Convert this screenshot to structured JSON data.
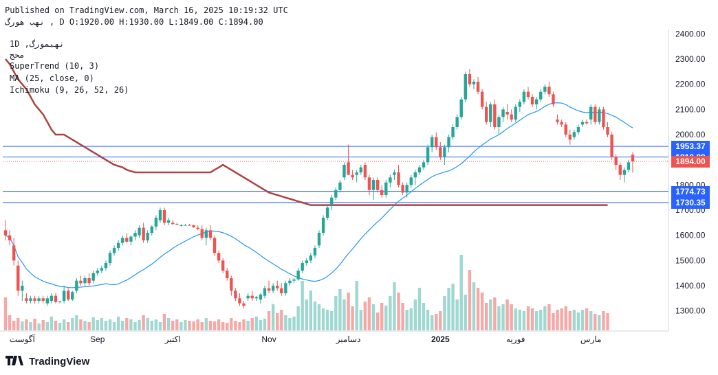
{
  "header": {
    "published": "Published on TradingView.com, March 16, 2025 10:19:32 UTC",
    "symbol_line": "نهب هورگ , D O:1920.00 H:1930.00 L:1849.00 C:1894.00"
  },
  "legend": {
    "symbol": "1D ,نهبمورگ",
    "exchange": "محج",
    "supertrend": "SuperTrend (10, 3)",
    "ma": "MA (25, close, 0)",
    "ichimoku": "Ichimoku (9, 26, 52, 26)"
  },
  "colors": {
    "up": "#26a69a",
    "down": "#ef5350",
    "supertrend_up": "#4caf50",
    "supertrend_down": "#a94442",
    "ma": "#2196f3",
    "hline": "#2962ff",
    "cloud_bull": "#d7ecd7",
    "cloud_bear": "#fbdcdc"
  },
  "footer": {
    "brand": "TradingView"
  },
  "chart_data": {
    "type": "candlestick",
    "title": "",
    "ylim": [
      1220,
      2420
    ],
    "y_ticks": [
      2400,
      2300,
      2200,
      2100,
      2000,
      1900,
      1800,
      1700,
      1600,
      1500,
      1400,
      1300
    ],
    "y_tick_labels": [
      "2400.00",
      "2300.00",
      "2200.00",
      "2100.00",
      "2000.00",
      "1900.00",
      "1800.00",
      "1700.00",
      "1600.00",
      "1500.00",
      "1400.00",
      "1300.00"
    ],
    "x_labels": [
      {
        "text": "آگوست",
        "index": 4
      },
      {
        "text": "Sep",
        "index": 22
      },
      {
        "text": "اکتبر",
        "index": 40
      },
      {
        "text": "Nov",
        "index": 63
      },
      {
        "text": "دسامبر",
        "index": 82
      },
      {
        "text": "2025",
        "index": 104
      },
      {
        "text": "فوریه",
        "index": 122
      },
      {
        "text": "مارس",
        "index": 140
      }
    ],
    "candles": [
      {
        "o": 1620,
        "h": 1660,
        "l": 1580,
        "c": 1600
      },
      {
        "o": 1600,
        "h": 1620,
        "l": 1560,
        "c": 1580
      },
      {
        "o": 1560,
        "h": 1590,
        "l": 1480,
        "c": 1500
      },
      {
        "o": 1480,
        "h": 1500,
        "l": 1360,
        "c": 1380
      },
      {
        "o": 1380,
        "h": 1420,
        "l": 1340,
        "c": 1400
      },
      {
        "o": 1350,
        "h": 1370,
        "l": 1330,
        "c": 1340
      },
      {
        "o": 1340,
        "h": 1360,
        "l": 1330,
        "c": 1350
      },
      {
        "o": 1350,
        "h": 1360,
        "l": 1330,
        "c": 1340
      },
      {
        "o": 1340,
        "h": 1360,
        "l": 1330,
        "c": 1350
      },
      {
        "o": 1350,
        "h": 1360,
        "l": 1330,
        "c": 1340
      },
      {
        "o": 1330,
        "h": 1360,
        "l": 1320,
        "c": 1350
      },
      {
        "o": 1340,
        "h": 1370,
        "l": 1330,
        "c": 1360
      },
      {
        "o": 1360,
        "h": 1370,
        "l": 1330,
        "c": 1335
      },
      {
        "o": 1335,
        "h": 1340,
        "l": 1330,
        "c": 1338
      },
      {
        "o": 1340,
        "h": 1400,
        "l": 1330,
        "c": 1380
      },
      {
        "o": 1380,
        "h": 1390,
        "l": 1340,
        "c": 1345
      },
      {
        "o": 1345,
        "h": 1380,
        "l": 1340,
        "c": 1375
      },
      {
        "o": 1380,
        "h": 1430,
        "l": 1370,
        "c": 1420
      },
      {
        "o": 1420,
        "h": 1440,
        "l": 1400,
        "c": 1410
      },
      {
        "o": 1410,
        "h": 1440,
        "l": 1400,
        "c": 1430
      },
      {
        "o": 1430,
        "h": 1450,
        "l": 1400,
        "c": 1410
      },
      {
        "o": 1420,
        "h": 1460,
        "l": 1410,
        "c": 1450
      },
      {
        "o": 1450,
        "h": 1470,
        "l": 1440,
        "c": 1460
      },
      {
        "o": 1460,
        "h": 1480,
        "l": 1450,
        "c": 1470
      },
      {
        "o": 1470,
        "h": 1500,
        "l": 1460,
        "c": 1490
      },
      {
        "o": 1490,
        "h": 1540,
        "l": 1480,
        "c": 1530
      },
      {
        "o": 1530,
        "h": 1560,
        "l": 1520,
        "c": 1550
      },
      {
        "o": 1550,
        "h": 1580,
        "l": 1540,
        "c": 1570
      },
      {
        "o": 1570,
        "h": 1600,
        "l": 1560,
        "c": 1590
      },
      {
        "o": 1590,
        "h": 1610,
        "l": 1570,
        "c": 1575
      },
      {
        "o": 1575,
        "h": 1600,
        "l": 1560,
        "c": 1595
      },
      {
        "o": 1595,
        "h": 1620,
        "l": 1580,
        "c": 1610
      },
      {
        "o": 1600,
        "h": 1640,
        "l": 1590,
        "c": 1630
      },
      {
        "o": 1630,
        "h": 1650,
        "l": 1570,
        "c": 1580
      },
      {
        "o": 1580,
        "h": 1620,
        "l": 1570,
        "c": 1610
      },
      {
        "o": 1610,
        "h": 1640,
        "l": 1600,
        "c": 1635
      },
      {
        "o": 1635,
        "h": 1680,
        "l": 1620,
        "c": 1670
      },
      {
        "o": 1660,
        "h": 1710,
        "l": 1650,
        "c": 1700
      },
      {
        "o": 1700,
        "h": 1710,
        "l": 1640,
        "c": 1650
      },
      {
        "o": 1650,
        "h": 1670,
        "l": 1640,
        "c": 1660
      },
      {
        "o": 1650,
        "h": 1660,
        "l": 1640,
        "c": 1645
      },
      {
        "o": 1645,
        "h": 1650,
        "l": 1640,
        "c": 1642
      },
      {
        "o": 1640,
        "h": 1645,
        "l": 1635,
        "c": 1640
      },
      {
        "o": 1640,
        "h": 1645,
        "l": 1638,
        "c": 1641
      },
      {
        "o": 1641,
        "h": 1645,
        "l": 1638,
        "c": 1640
      },
      {
        "o": 1640,
        "h": 1642,
        "l": 1630,
        "c": 1632
      },
      {
        "o": 1630,
        "h": 1640,
        "l": 1620,
        "c": 1625
      },
      {
        "o": 1625,
        "h": 1640,
        "l": 1580,
        "c": 1590
      },
      {
        "o": 1590,
        "h": 1630,
        "l": 1560,
        "c": 1620
      },
      {
        "o": 1620,
        "h": 1640,
        "l": 1580,
        "c": 1590
      },
      {
        "o": 1590,
        "h": 1600,
        "l": 1520,
        "c": 1530
      },
      {
        "o": 1530,
        "h": 1540,
        "l": 1490,
        "c": 1500
      },
      {
        "o": 1500,
        "h": 1510,
        "l": 1450,
        "c": 1460
      },
      {
        "o": 1460,
        "h": 1470,
        "l": 1420,
        "c": 1430
      },
      {
        "o": 1430,
        "h": 1440,
        "l": 1360,
        "c": 1380
      },
      {
        "o": 1380,
        "h": 1390,
        "l": 1340,
        "c": 1350
      },
      {
        "o": 1350,
        "h": 1370,
        "l": 1320,
        "c": 1330
      },
      {
        "o": 1330,
        "h": 1340,
        "l": 1310,
        "c": 1320
      },
      {
        "o": 1350,
        "h": 1370,
        "l": 1340,
        "c": 1360
      },
      {
        "o": 1360,
        "h": 1380,
        "l": 1340,
        "c": 1350
      },
      {
        "o": 1350,
        "h": 1360,
        "l": 1340,
        "c": 1355
      },
      {
        "o": 1345,
        "h": 1370,
        "l": 1330,
        "c": 1365
      },
      {
        "o": 1360,
        "h": 1400,
        "l": 1350,
        "c": 1390
      },
      {
        "o": 1390,
        "h": 1420,
        "l": 1370,
        "c": 1380
      },
      {
        "o": 1380,
        "h": 1410,
        "l": 1370,
        "c": 1400
      },
      {
        "o": 1400,
        "h": 1420,
        "l": 1380,
        "c": 1390
      },
      {
        "o": 1390,
        "h": 1410,
        "l": 1360,
        "c": 1370
      },
      {
        "o": 1370,
        "h": 1420,
        "l": 1360,
        "c": 1410
      },
      {
        "o": 1410,
        "h": 1430,
        "l": 1400,
        "c": 1420
      },
      {
        "o": 1420,
        "h": 1430,
        "l": 1410,
        "c": 1425
      },
      {
        "o": 1425,
        "h": 1470,
        "l": 1420,
        "c": 1460
      },
      {
        "o": 1460,
        "h": 1500,
        "l": 1450,
        "c": 1490
      },
      {
        "o": 1490,
        "h": 1510,
        "l": 1480,
        "c": 1500
      },
      {
        "o": 1500,
        "h": 1530,
        "l": 1490,
        "c": 1520
      },
      {
        "o": 1520,
        "h": 1560,
        "l": 1510,
        "c": 1550
      },
      {
        "o": 1560,
        "h": 1620,
        "l": 1550,
        "c": 1610
      },
      {
        "o": 1610,
        "h": 1680,
        "l": 1600,
        "c": 1670
      },
      {
        "o": 1670,
        "h": 1720,
        "l": 1660,
        "c": 1710
      },
      {
        "o": 1720,
        "h": 1760,
        "l": 1700,
        "c": 1750
      },
      {
        "o": 1750,
        "h": 1790,
        "l": 1740,
        "c": 1780
      },
      {
        "o": 1780,
        "h": 1820,
        "l": 1770,
        "c": 1810
      },
      {
        "o": 1830,
        "h": 1890,
        "l": 1820,
        "c": 1880
      },
      {
        "o": 1890,
        "h": 1960,
        "l": 1850,
        "c": 1840
      },
      {
        "o": 1840,
        "h": 1860,
        "l": 1820,
        "c": 1830
      },
      {
        "o": 1840,
        "h": 1860,
        "l": 1810,
        "c": 1850
      },
      {
        "o": 1850,
        "h": 1880,
        "l": 1840,
        "c": 1870
      },
      {
        "o": 1880,
        "h": 1890,
        "l": 1820,
        "c": 1830
      },
      {
        "o": 1830,
        "h": 1840,
        "l": 1760,
        "c": 1780
      },
      {
        "o": 1780,
        "h": 1830,
        "l": 1740,
        "c": 1820
      },
      {
        "o": 1820,
        "h": 1830,
        "l": 1770,
        "c": 1780
      },
      {
        "o": 1780,
        "h": 1800,
        "l": 1750,
        "c": 1760
      },
      {
        "o": 1760,
        "h": 1820,
        "l": 1750,
        "c": 1810
      },
      {
        "o": 1810,
        "h": 1840,
        "l": 1790,
        "c": 1830
      },
      {
        "o": 1840,
        "h": 1860,
        "l": 1820,
        "c": 1850
      },
      {
        "o": 1850,
        "h": 1880,
        "l": 1790,
        "c": 1800
      },
      {
        "o": 1800,
        "h": 1810,
        "l": 1760,
        "c": 1770
      },
      {
        "o": 1770,
        "h": 1810,
        "l": 1750,
        "c": 1800
      },
      {
        "o": 1800,
        "h": 1840,
        "l": 1790,
        "c": 1830
      },
      {
        "o": 1830,
        "h": 1860,
        "l": 1800,
        "c": 1850
      },
      {
        "o": 1850,
        "h": 1880,
        "l": 1840,
        "c": 1870
      },
      {
        "o": 1870,
        "h": 1900,
        "l": 1860,
        "c": 1890
      },
      {
        "o": 1890,
        "h": 1960,
        "l": 1880,
        "c": 1950
      },
      {
        "o": 1950,
        "h": 2000,
        "l": 1930,
        "c": 1990
      },
      {
        "o": 1990,
        "h": 2010,
        "l": 1940,
        "c": 1950
      },
      {
        "o": 1950,
        "h": 1970,
        "l": 1900,
        "c": 1910
      },
      {
        "o": 1910,
        "h": 1960,
        "l": 1880,
        "c": 1950
      },
      {
        "o": 1950,
        "h": 2000,
        "l": 1930,
        "c": 1990
      },
      {
        "o": 1990,
        "h": 2040,
        "l": 1980,
        "c": 2030
      },
      {
        "o": 2030,
        "h": 2080,
        "l": 2020,
        "c": 2070
      },
      {
        "o": 2070,
        "h": 2150,
        "l": 2060,
        "c": 2140
      },
      {
        "o": 2140,
        "h": 2250,
        "l": 2130,
        "c": 2240
      },
      {
        "o": 2240,
        "h": 2260,
        "l": 2190,
        "c": 2200
      },
      {
        "o": 2200,
        "h": 2220,
        "l": 2180,
        "c": 2210
      },
      {
        "o": 2210,
        "h": 2230,
        "l": 2160,
        "c": 2170
      },
      {
        "o": 2170,
        "h": 2180,
        "l": 2100,
        "c": 2110
      },
      {
        "o": 2110,
        "h": 2130,
        "l": 2040,
        "c": 2050
      },
      {
        "o": 2050,
        "h": 2130,
        "l": 2030,
        "c": 2120
      },
      {
        "o": 2120,
        "h": 2140,
        "l": 2020,
        "c": 2030
      },
      {
        "o": 2030,
        "h": 2080,
        "l": 2000,
        "c": 2070
      },
      {
        "o": 2070,
        "h": 2110,
        "l": 2050,
        "c": 2100
      },
      {
        "o": 2090,
        "h": 2120,
        "l": 2060,
        "c": 2080
      },
      {
        "o": 2080,
        "h": 2100,
        "l": 2050,
        "c": 2060
      },
      {
        "o": 2060,
        "h": 2120,
        "l": 2050,
        "c": 2110
      },
      {
        "o": 2110,
        "h": 2140,
        "l": 2090,
        "c": 2130
      },
      {
        "o": 2130,
        "h": 2180,
        "l": 2120,
        "c": 2170
      },
      {
        "o": 2170,
        "h": 2190,
        "l": 2140,
        "c": 2150
      },
      {
        "o": 2150,
        "h": 2160,
        "l": 2110,
        "c": 2120
      },
      {
        "o": 2120,
        "h": 2150,
        "l": 2100,
        "c": 2140
      },
      {
        "o": 2140,
        "h": 2180,
        "l": 2130,
        "c": 2170
      },
      {
        "o": 2170,
        "h": 2200,
        "l": 2160,
        "c": 2190
      },
      {
        "o": 2190,
        "h": 2210,
        "l": 2150,
        "c": 2160
      },
      {
        "o": 2160,
        "h": 2170,
        "l": 2110,
        "c": 2120
      },
      {
        "o": 2060,
        "h": 2080,
        "l": 2040,
        "c": 2050
      },
      {
        "o": 2050,
        "h": 2060,
        "l": 2030,
        "c": 2040
      },
      {
        "o": 2040,
        "h": 2050,
        "l": 1990,
        "c": 2000
      },
      {
        "o": 2000,
        "h": 2020,
        "l": 1960,
        "c": 1980
      },
      {
        "o": 1990,
        "h": 2020,
        "l": 1980,
        "c": 2010
      },
      {
        "o": 2010,
        "h": 2040,
        "l": 2000,
        "c": 2030
      },
      {
        "o": 2040,
        "h": 2060,
        "l": 2030,
        "c": 2050
      },
      {
        "o": 2050,
        "h": 2060,
        "l": 2040,
        "c": 2045
      },
      {
        "o": 2060,
        "h": 2120,
        "l": 2040,
        "c": 2110
      },
      {
        "o": 2110,
        "h": 2120,
        "l": 2040,
        "c": 2050
      },
      {
        "o": 2050,
        "h": 2110,
        "l": 2040,
        "c": 2100
      },
      {
        "o": 2100,
        "h": 2110,
        "l": 2020,
        "c": 2030
      },
      {
        "o": 2030,
        "h": 2050,
        "l": 1990,
        "c": 2000
      },
      {
        "o": 2000,
        "h": 2010,
        "l": 1900,
        "c": 1910
      },
      {
        "o": 1910,
        "h": 1920,
        "l": 1860,
        "c": 1880
      },
      {
        "o": 1880,
        "h": 1890,
        "l": 1820,
        "c": 1840
      },
      {
        "o": 1840,
        "h": 1870,
        "l": 1810,
        "c": 1860
      },
      {
        "o": 1860,
        "h": 1900,
        "l": 1850,
        "c": 1890
      },
      {
        "o": 1920,
        "h": 1930,
        "l": 1849,
        "c": 1894
      }
    ],
    "volume": [
      48,
      22,
      14,
      18,
      13,
      16,
      12,
      17,
      10,
      15,
      12,
      20,
      14,
      11,
      16,
      12,
      18,
      22,
      16,
      14,
      12,
      19,
      15,
      18,
      14,
      16,
      12,
      20,
      14,
      18,
      16,
      12,
      15,
      22,
      18,
      14,
      16,
      12,
      24,
      18,
      14,
      16,
      12,
      15,
      14,
      13,
      16,
      12,
      18,
      14,
      13,
      16,
      12,
      11,
      18,
      14,
      12,
      16,
      14,
      18,
      20,
      15,
      17,
      28,
      38,
      25,
      30,
      22,
      18,
      20,
      35,
      72,
      45,
      58,
      42,
      38,
      32,
      30,
      28,
      50,
      60,
      45,
      55,
      35,
      72,
      30,
      42,
      48,
      38,
      26,
      40,
      36,
      50,
      70,
      55,
      40,
      30,
      32,
      45,
      62,
      40,
      30,
      22,
      24,
      28,
      50,
      62,
      68,
      45,
      110,
      52,
      88,
      70,
      62,
      55,
      40,
      45,
      48,
      35,
      38,
      45,
      38,
      32,
      30,
      28,
      35,
      32,
      28,
      30,
      35,
      38,
      25,
      30,
      32,
      35,
      28,
      30,
      26,
      30,
      32,
      28,
      24,
      22,
      28,
      25
    ],
    "supertrend": [
      2300,
      2280,
      2250,
      2220,
      2200,
      2180,
      2150,
      2120,
      2100,
      2080,
      2050,
      2020,
      2000,
      2000,
      2000,
      1990,
      1980,
      1970,
      1960,
      1950,
      1940,
      1930,
      1920,
      1910,
      1900,
      1890,
      1880,
      1875,
      1870,
      1860,
      1855,
      1850,
      1850,
      1850,
      1850,
      1850,
      1850,
      1850,
      1850,
      1850,
      1850,
      1850,
      1850,
      1850,
      1850,
      1850,
      1850,
      1850,
      1850,
      1850,
      1860,
      1870,
      1880,
      1870,
      1860,
      1850,
      1840,
      1830,
      1820,
      1810,
      1800,
      1790,
      1780,
      1770,
      1765,
      1760,
      1755,
      1750,
      1745,
      1740,
      1735,
      1730,
      1725,
      1720,
      1720,
      1720,
      1720,
      1720,
      1720,
      1720,
      1720,
      1720,
      1720,
      1720,
      1720,
      1720,
      1720,
      1720,
      1720,
      1720,
      1720,
      1720,
      1720,
      1720,
      1720,
      1720,
      1720,
      1720,
      1720,
      1720,
      1720,
      1720,
      1720,
      1720,
      1720,
      1720,
      1720,
      1720,
      1720,
      1720,
      1720,
      1720,
      1720,
      1720,
      1720,
      1720,
      1720,
      1720,
      1720,
      1720,
      1720,
      1720,
      1720,
      1720,
      1720,
      1720,
      1720,
      1720,
      1720,
      1720,
      1720,
      1720,
      1720,
      1720,
      1720,
      1720,
      1720,
      1720,
      1720,
      1720,
      1720,
      1720,
      1720,
      1720,
      1720
    ],
    "horizontal_levels": [
      {
        "value": 1953.37,
        "label": "1953.37"
      },
      {
        "value": 1910.89,
        "label": "1910.89"
      },
      {
        "value": 1774.73,
        "label": "1774.73"
      },
      {
        "value": 1730.35,
        "label": "1730.35"
      }
    ],
    "last_price": {
      "value": 1894.0,
      "label": "1894.00"
    }
  }
}
